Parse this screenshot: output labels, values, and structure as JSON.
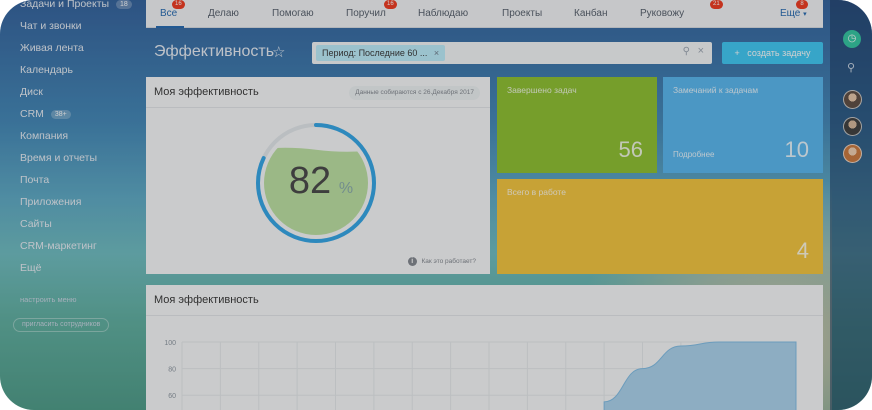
{
  "sidebar": {
    "items": [
      {
        "label": "Задачи и Проекты",
        "badge": "18"
      },
      {
        "label": "Чат и звонки"
      },
      {
        "label": "Живая лента"
      },
      {
        "label": "Календарь"
      },
      {
        "label": "Диск"
      },
      {
        "label": "CRM",
        "badge": "38+"
      },
      {
        "label": "Компания"
      },
      {
        "label": "Время и отчеты"
      },
      {
        "label": "Почта"
      },
      {
        "label": "Приложения"
      },
      {
        "label": "Сайты"
      },
      {
        "label": "CRM-маркетинг"
      },
      {
        "label": "Ещё"
      }
    ],
    "configure_menu": "настроить меню",
    "invite_button": "пригласить сотрудников"
  },
  "topnav": {
    "tabs": [
      {
        "label": "Все",
        "badge": "16",
        "active": true
      },
      {
        "label": "Делаю"
      },
      {
        "label": "Помогаю"
      },
      {
        "label": "Поручил",
        "badge": "16"
      },
      {
        "label": "Наблюдаю"
      },
      {
        "label": "Проекты"
      },
      {
        "label": "Канбан"
      },
      {
        "label": "Руковожу",
        "badge": "21"
      },
      {
        "label": "Еще",
        "badge": "8"
      }
    ]
  },
  "header": {
    "title": "Эффективность",
    "filter_chip": "Период: Последние 60 ...",
    "create_button": "создать задачу"
  },
  "efficiency_card": {
    "title": "Моя эффективность",
    "note": "Данные собираются с 26.Декабря 2017",
    "value": "82",
    "unit": "%",
    "percent": 82,
    "help_link": "Как это работает?"
  },
  "tiles": {
    "completed": {
      "label": "Завершено задач",
      "value": "56",
      "color": "#8cbf2c"
    },
    "remarks": {
      "label": "Замечаний к задачам",
      "sublabel": "Подробнее",
      "value": "10",
      "color": "#55b6f0"
    },
    "in_work": {
      "label": "Всего в работе",
      "value": "4",
      "color": "#f4c43a"
    }
  },
  "chart_card": {
    "title": "Моя эффективность"
  },
  "chart_data": {
    "type": "area",
    "title": "Моя эффективность",
    "xlabel": "",
    "ylabel": "",
    "ylim": [
      0,
      100
    ],
    "y_ticks": [
      100,
      80,
      60
    ],
    "x": [
      0,
      1,
      2,
      3,
      4,
      5,
      6,
      7,
      8,
      9,
      10,
      11,
      12,
      13,
      14,
      15,
      16
    ],
    "values": [
      null,
      null,
      null,
      null,
      null,
      null,
      null,
      null,
      null,
      null,
      null,
      55,
      80,
      97,
      100,
      100,
      100
    ],
    "grid": true
  },
  "colors": {
    "accent": "#2067b0",
    "create_button": "#3bc8f5",
    "badge": "#f0371b"
  }
}
